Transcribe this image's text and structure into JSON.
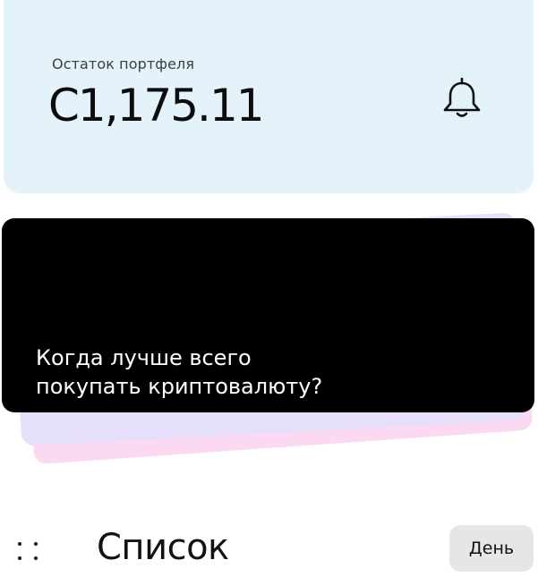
{
  "balance": {
    "label": "Остаток портфеля",
    "amount": "C1,175.11",
    "notifications_icon": "bell-icon"
  },
  "promo": {
    "text_line1": "Когда лучше всего",
    "text_line2": "покупать криптовалюту?"
  },
  "list": {
    "title": "Список",
    "layout_icon": "grid-dots-icon",
    "period_button_label": "День"
  },
  "colors": {
    "balance_card_bg": "#e4f3f9",
    "promo_card_bg": "#000000",
    "promo_layer_lavender": "#e5dffc",
    "promo_layer_pink": "#fbd9f3",
    "period_button_bg": "#e6e6e6"
  }
}
